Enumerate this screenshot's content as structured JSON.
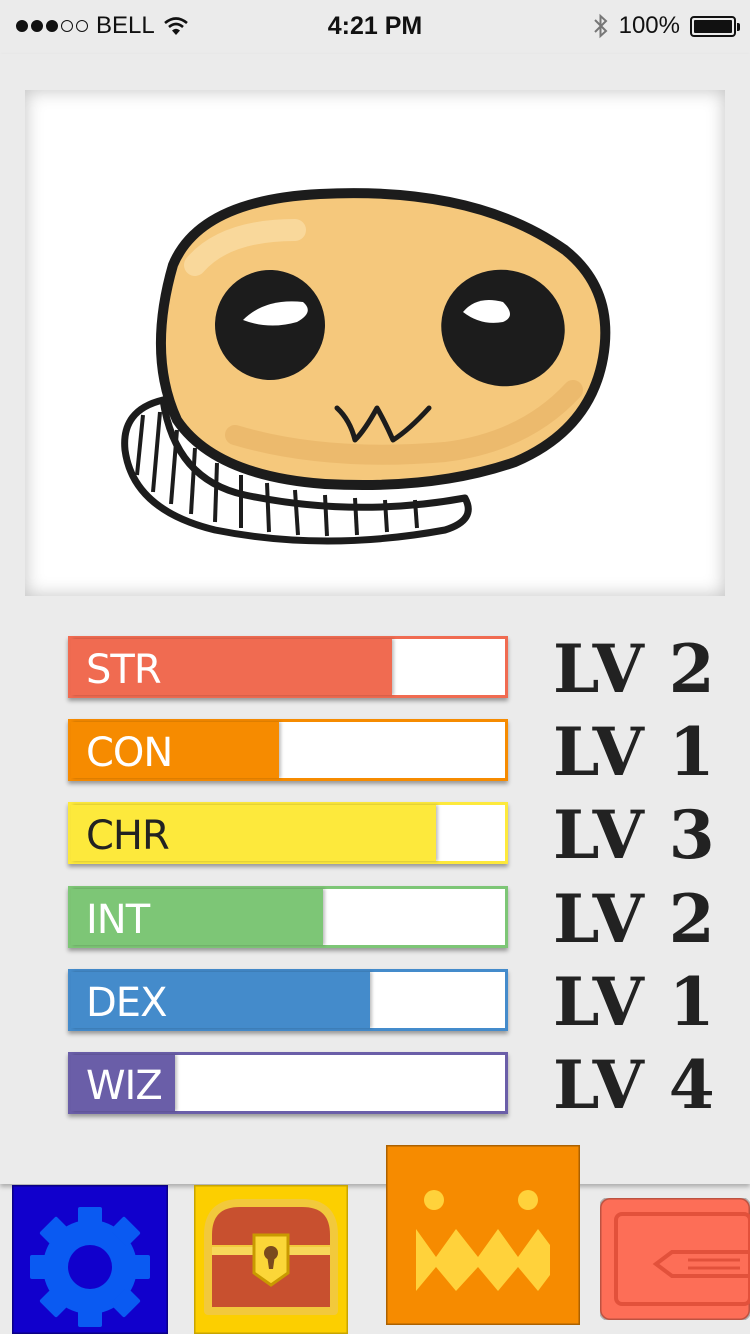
{
  "status_bar": {
    "carrier": "BELL",
    "signal_bars_filled": 3,
    "signal_bars_total": 5,
    "time": "4:21 PM",
    "battery": "100%",
    "icons": [
      "wifi-icon",
      "bluetooth-icon",
      "battery-icon"
    ]
  },
  "portrait": {
    "subject": "creature-portrait"
  },
  "stats": [
    {
      "label": "STR",
      "level": "LV 2",
      "fill": 0.74,
      "color": "#f06b51"
    },
    {
      "label": "CON",
      "level": "LV 1",
      "fill": 0.48,
      "color": "#f68b00"
    },
    {
      "label": "CHR",
      "level": "LV 3",
      "fill": 0.84,
      "color": "#fde93c"
    },
    {
      "label": "INT",
      "level": "LV 2",
      "fill": 0.58,
      "color": "#7dc676"
    },
    {
      "label": "DEX",
      "level": "LV 1",
      "fill": 0.69,
      "color": "#448bcb"
    },
    {
      "label": "WIZ",
      "level": "LV 4",
      "fill": 0.24,
      "color": "#6a5ea8"
    }
  ],
  "nav": {
    "tabs": [
      {
        "name": "settings",
        "icon": "gear-icon",
        "color": "#1100cc"
      },
      {
        "name": "inventory",
        "icon": "treasure-chest-icon",
        "color": "#fccf00"
      },
      {
        "name": "character",
        "icon": "monster-face-icon",
        "color": "#f68b00",
        "active": true
      },
      {
        "name": "tickets",
        "icon": "ticket-icon",
        "color": "#fd6e57"
      }
    ]
  }
}
